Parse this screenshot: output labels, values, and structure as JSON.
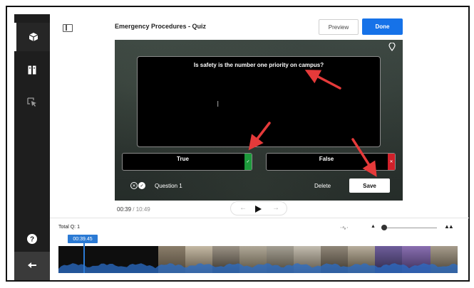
{
  "header": {
    "title": "Emergency Procedures - Quiz",
    "preview_label": "Preview",
    "done_label": "Done"
  },
  "sidebar": {
    "items": [
      {
        "icon": "cube-icon",
        "active": true
      },
      {
        "icon": "book-icon",
        "active": false
      },
      {
        "icon": "pointer-select-icon",
        "active": false
      }
    ],
    "help_icon": "question-mark-icon",
    "back_icon": "back-arrow-icon"
  },
  "question": {
    "text": "Is safety is the number one priority on campus?",
    "answers": [
      {
        "label": "True",
        "correct": true
      },
      {
        "label": "False",
        "correct": false
      }
    ],
    "number_label": "Question 1",
    "delete_label": "Delete",
    "save_label": "Save"
  },
  "playback": {
    "current_time": "00:39",
    "separator": " / ",
    "total_time": "10:49"
  },
  "timeline": {
    "total_questions_label": "Total Q: 1",
    "timecode_badge": "00:39.45"
  },
  "colors": {
    "accent_blue": "#1672e8",
    "correct_green": "#1c9a3b",
    "incorrect_red": "#d0202a",
    "annotation_red": "#e53a3a",
    "rail_dark": "#1e1e1e"
  }
}
